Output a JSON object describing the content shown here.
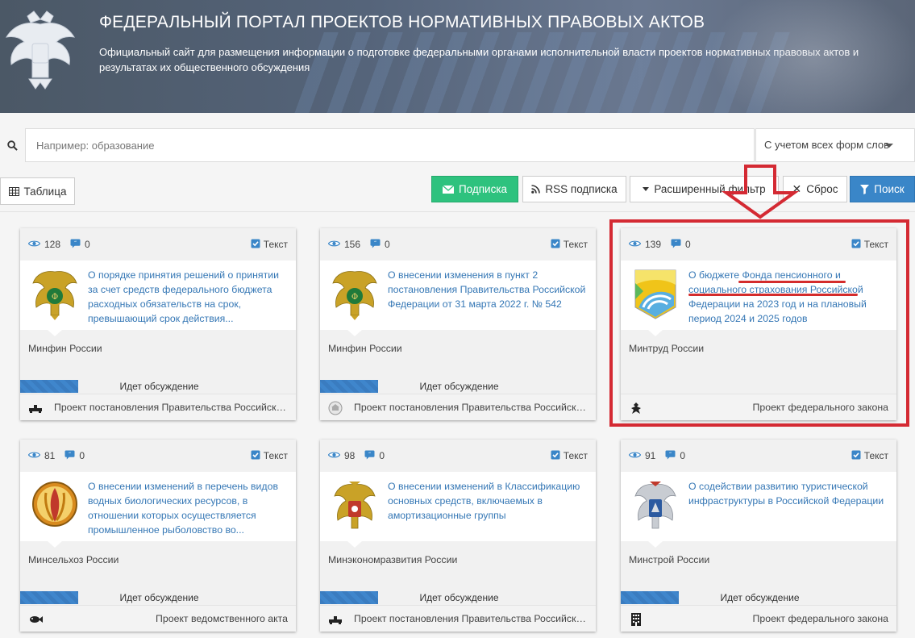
{
  "header": {
    "title": "ФЕДЕРАЛЬНЫЙ ПОРТАЛ ПРОЕКТОВ НОРМАТИВНЫХ ПРАВОВЫХ АКТОВ",
    "subtitle": "Официальный сайт для размещения информации о подготовке федеральными органами исполнительной власти проектов нормативных правовых актов и результатах их общественного обсуждения"
  },
  "search": {
    "placeholder": "Например: образование",
    "morphology_option": "С учетом всех форм слов"
  },
  "toolbar": {
    "table_label": "Таблица",
    "subscribe_label": "Подписка",
    "rss_label": "RSS подписка",
    "extended_filter_label": "Расширенный фильтр",
    "reset_label": "Сброс",
    "search_label": "Поиск"
  },
  "colors": {
    "accent_blue": "#3577b5",
    "subscribe_green": "#2ec27e",
    "search_blue": "#3a86c8",
    "annotation_red": "#d42a33"
  },
  "cards": [
    {
      "views": "128",
      "comments": "0",
      "tag": "Текст",
      "title": "О порядке принятия решений о принятии за счет средств федерального бюджета расходных обязательств на срок, превышающий срок действия...",
      "org": "Минфин России",
      "status": "Идет обсуждение",
      "doc_type": "Проект постановления Правительства Российской Федерации",
      "logo": "minfin-emblem",
      "type_icon": "gavel-icon"
    },
    {
      "views": "156",
      "comments": "0",
      "tag": "Текст",
      "title": "О внесении изменения в пункт 2 постановления Правительства Российской Федерации от 31 марта 2022 г. № 542",
      "org": "Минфин России",
      "status": "Идет обсуждение",
      "doc_type": "Проект постановления Правительства Российской Федерации",
      "logo": "minfin-emblem",
      "type_icon": "government-seal-icon"
    },
    {
      "views": "139",
      "comments": "0",
      "tag": "Текст",
      "title": "О бюджете Фонда пенсионного и социального страхования Российской Федерации на 2023 год и на плановый период 2024 и 2025 годов",
      "org": "Минтруд России",
      "status": "",
      "doc_type": "Проект федерального закона",
      "logo": "mintrud-emblem",
      "type_icon": "eagle-icon"
    },
    {
      "views": "81",
      "comments": "0",
      "tag": "Текст",
      "title": "О внесении изменений в перечень видов водных биологических ресурсов, в отношении которых осуществляется промышленное рыболовство во...",
      "org": "Минсельхоз России",
      "status": "Идет обсуждение",
      "doc_type": "Проект ведомственного акта",
      "logo": "minselhoz-emblem",
      "type_icon": "fish-icon"
    },
    {
      "views": "98",
      "comments": "0",
      "tag": "Текст",
      "title": "О внесении изменений в Классификацию основных средств, включаемых в амортизационные группы",
      "org": "Минэкономразвития России",
      "status": "Идет обсуждение",
      "doc_type": "Проект постановления Правительства Российской Федерации",
      "logo": "mineconom-emblem",
      "type_icon": "gavel-icon"
    },
    {
      "views": "91",
      "comments": "0",
      "tag": "Текст",
      "title": "О содействии развитию туристической инфраструктуры в Российской Федерации",
      "org": "Минстрой России",
      "status": "Идет обсуждение",
      "doc_type": "Проект федерального закона",
      "logo": "minstroy-emblem",
      "type_icon": "building-icon"
    }
  ]
}
